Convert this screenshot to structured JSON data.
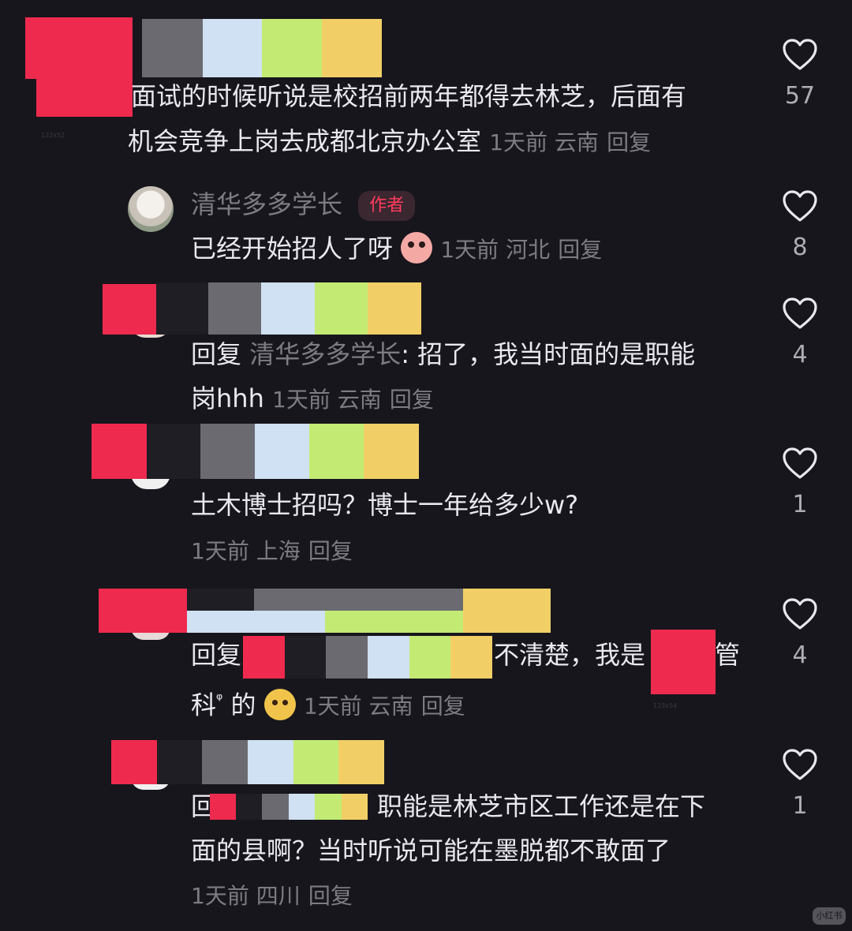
{
  "comments": [
    {
      "text_line1": "面试的时候听说是校招前两年都得去林芝，后面有",
      "text_line2": "机会竞争上岗去成都北京办公室",
      "meta": "1天前 云南",
      "reply_label": "回复",
      "likes": "57",
      "avatar_watermark": "122x52"
    },
    {
      "username": "清华多多学长",
      "badge": "作者",
      "text": "已经开始招人了呀",
      "emoji": "shocked-face-emoji",
      "meta": "1天前 河北",
      "reply_label": "回复",
      "likes": "8"
    },
    {
      "reply_prefix": "回复",
      "reply_to": "清华多多学长",
      "text_line1": ": 招了，我当时面的是职能",
      "text_line2": "岗hhh",
      "meta": "1天前 云南",
      "reply_label": "回复",
      "likes": "4"
    },
    {
      "text": "土木博士招吗？博士一年给多少w?",
      "meta": "1天前 上海",
      "reply_label": "回复",
      "likes": "1"
    },
    {
      "reply_prefix": "回复",
      "text_mid": "不清楚，我是",
      "text_end": "管",
      "text_line2": "科",
      "search_mark": "ᵠ",
      "text_line2b": " 的",
      "emoji": "dog-face-emoji",
      "meta": "1天前 云南",
      "reply_label": "回复",
      "likes": "4",
      "redaction_watermark": "123x54"
    },
    {
      "reply_prefix": "回",
      "text_line1": "职能是林芝市区工作还是在下",
      "text_line2": "面的县啊？当时听说可能在墨脱都不敢面了",
      "meta": "1天前 四川",
      "reply_label": "回复",
      "likes": "1"
    }
  ],
  "colors": {
    "background": "#17161d",
    "text": "#e9e8ef",
    "meta": "#7d7c83",
    "redaction": "#ee2a4e",
    "author_badge": "#ff3b5c"
  },
  "corner_watermark": "小红书"
}
